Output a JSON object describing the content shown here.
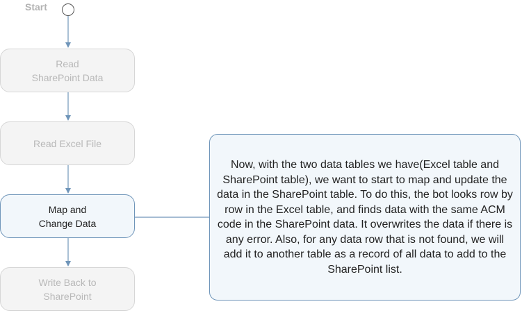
{
  "start": {
    "label": "Start"
  },
  "steps": [
    {
      "label": "Read\nSharePoint Data",
      "state": "inactive"
    },
    {
      "label": "Read Excel File",
      "state": "inactive"
    },
    {
      "label": "Map and\nChange Data",
      "state": "active"
    },
    {
      "label": "Write Back to\nSharePoint",
      "state": "inactive"
    }
  ],
  "note": {
    "text": "Now, with the two data tables we have(Excel table and SharePoint table), we want to start to map and update the data in the SharePoint table. To do this, the bot looks row by row in the Excel table, and finds data with the same ACM code in the SharePoint data. It overwrites the data if there is any error. Also, for any data row that is not found, we will add it to another table as a record of all data to add to the SharePoint list."
  },
  "colors": {
    "connector": "#6f95b9",
    "active_border": "#6f95b9",
    "active_fill": "#f2f7fb",
    "inactive_fill": "#f4f4f4",
    "inactive_text": "#b8b8b8"
  }
}
